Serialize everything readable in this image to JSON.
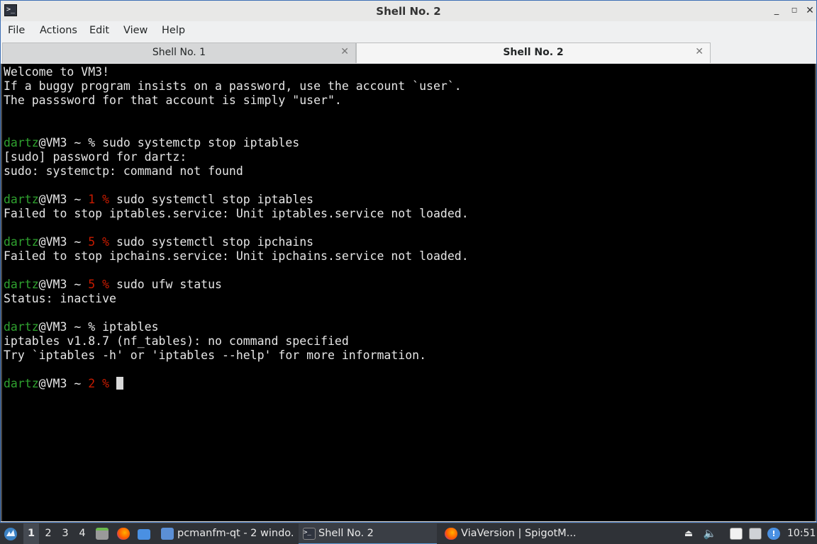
{
  "window": {
    "title": "Shell No. 2",
    "icon": "terminal-icon",
    "controls": {
      "minimize": "_",
      "maximize": "◻",
      "close": "✕"
    }
  },
  "menu": [
    "File",
    "Actions",
    "Edit",
    "View",
    "Help"
  ],
  "tabs": [
    {
      "label": "Shell No. 1",
      "active": false,
      "close": "✕"
    },
    {
      "label": "Shell No. 2",
      "active": true,
      "close": "✕"
    }
  ],
  "terminal": {
    "colors": {
      "background": "#000000",
      "text": "#e6e6e6",
      "user": "#2fa22f",
      "exit_code": "#c91b00"
    },
    "lines": [
      "Welcome to VM3!",
      "If a buggy program insists on a password, use the account `user`.",
      "The passsword for that account is simply \"user\".",
      "",
      "",
      "dartz@VM3 ~ % sudo systemctp stop iptables",
      "[sudo] password for dartz:",
      "sudo: systemctp: command not found",
      "",
      "dartz@VM3 ~ 1 % sudo systemctl stop iptables",
      "Failed to stop iptables.service: Unit iptables.service not loaded.",
      "",
      "dartz@VM3 ~ 5 % sudo systemctl stop ipchains",
      "Failed to stop ipchains.service: Unit ipchains.service not loaded.",
      "",
      "dartz@VM3 ~ 5 % sudo ufw status",
      "Status: inactive",
      "",
      "dartz@VM3 ~ % iptables",
      "iptables v1.8.7 (nf_tables): no command specified",
      "Try `iptables -h' or 'iptables --help' for more information.",
      "",
      "dartz@VM3 ~ 2 % "
    ]
  },
  "taskbar": {
    "start_icon": "lxqt-start-icon",
    "desktops": [
      "1",
      "2",
      "3",
      "4"
    ],
    "current_desktop": "1",
    "launchers": [
      "file-manager-icon",
      "firefox-icon",
      "show-desktop-icon"
    ],
    "tasks": [
      {
        "label": "pcmanfm-qt - 2 windo...",
        "icon": "folder-icon"
      },
      {
        "label": "Shell No. 2",
        "icon": "terminal-icon",
        "active": true
      },
      {
        "label": "ViaVersion | SpigotM...",
        "icon": "firefox-icon"
      }
    ],
    "tray": [
      "eject-icon",
      "volume-icon",
      "clipboard-icon",
      "network-icon",
      "notification-icon"
    ],
    "clock": "10:51"
  }
}
